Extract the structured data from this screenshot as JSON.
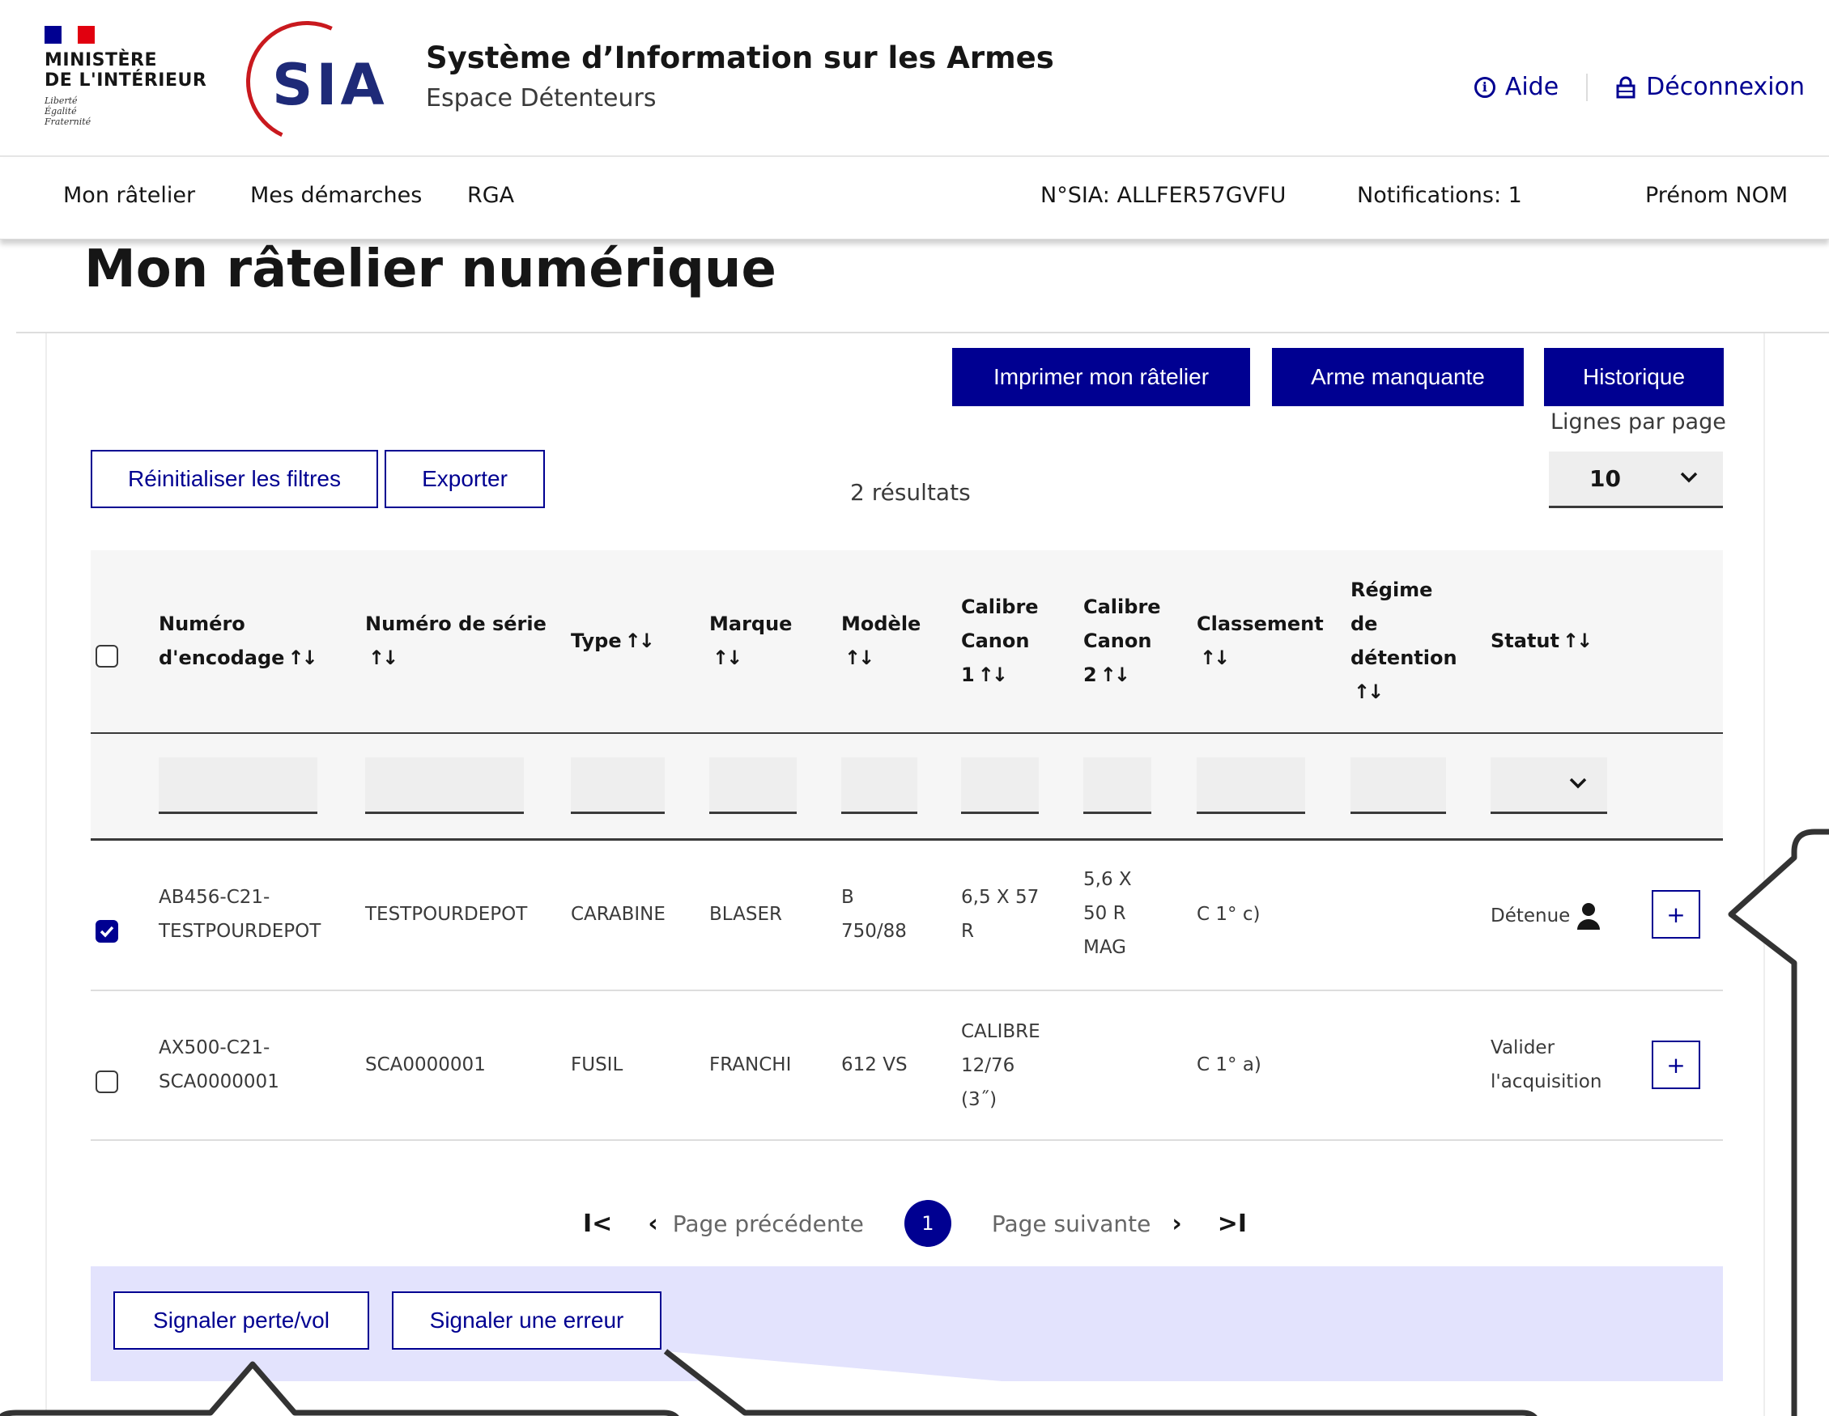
{
  "header": {
    "ministere_line1": "MINISTÈRE",
    "ministere_line2": "DE L'INTÉRIEUR",
    "devise": [
      "Liberté",
      "Égalité",
      "Fraternité"
    ],
    "logo_text": "SIA",
    "app_title": "Système d’Information sur les Armes",
    "app_subtitle": "Espace Détenteurs",
    "help_label": "Aide",
    "logout_label": "Déconnexion"
  },
  "nav": {
    "items": [
      "Mon râtelier",
      "Mes démarches",
      "RGA"
    ],
    "sia_number": "N°SIA: ALLFER57GVFU",
    "notifications": "Notifications: 1",
    "user": "Prénom NOM"
  },
  "page": {
    "title": "Mon râtelier numérique"
  },
  "toolbar": {
    "print_label": "Imprimer mon râtelier",
    "missing_label": "Arme manquante",
    "history_label": "Historique",
    "reset_label": "Réinitialiser les filtres",
    "export_label": "Exporter",
    "results_text": "2 résultats",
    "lines_per_page_label": "Lignes par page",
    "lines_per_page_value": "10"
  },
  "table": {
    "headers": {
      "encodage": [
        "Numéro",
        "d'encodage"
      ],
      "serie": [
        "Numéro de série",
        ""
      ],
      "type": "Type",
      "marque": [
        "Marque",
        ""
      ],
      "modele": [
        "Modèle",
        ""
      ],
      "calibre1": [
        "Calibre",
        "Canon",
        "1"
      ],
      "calibre2": [
        "Calibre",
        "Canon",
        "2"
      ],
      "classement": [
        "Classement",
        ""
      ],
      "regime": [
        "Régime",
        "de",
        "détention",
        ""
      ],
      "statut": "Statut"
    },
    "sort_glyph": "↑↓",
    "rows": [
      {
        "checked": true,
        "encodage": [
          "AB456-C21-",
          "TESTPOURDEPOT"
        ],
        "serie": "TESTPOURDEPOT",
        "type": "CARABINE",
        "marque": "BLASER",
        "modele": [
          "B",
          "750/88"
        ],
        "calibre1": [
          "6,5 X 57",
          "R"
        ],
        "calibre2": [
          "5,6 X",
          "50 R",
          "MAG"
        ],
        "classement": "C 1° c)",
        "regime": "",
        "statut": "Détenue"
      },
      {
        "checked": false,
        "encodage": [
          "AX500-C21-",
          "SCA0000001"
        ],
        "serie": "SCA0000001",
        "type": "FUSIL",
        "marque": "FRANCHI",
        "modele": [
          "612 VS"
        ],
        "calibre1": [
          "CALIBRE",
          "12/76",
          "(3˝)"
        ],
        "calibre2": [],
        "classement": "C 1° a)",
        "regime": "",
        "statut": [
          "Valider",
          "l'acquisition"
        ]
      }
    ],
    "expand_label": "+"
  },
  "pagination": {
    "first": "I<",
    "prev_label": "Page précédente",
    "current": "1",
    "next_label": "Page suivante",
    "last": ">I"
  },
  "actions": {
    "loss_label": "Signaler perte/vol",
    "error_label": "Signaler une erreur"
  },
  "colors": {
    "primary": "#000091",
    "primary_light": "#e3e3fd",
    "marianne_red": "#e1000f",
    "text": "#161616",
    "muted": "#3a3a3a"
  }
}
